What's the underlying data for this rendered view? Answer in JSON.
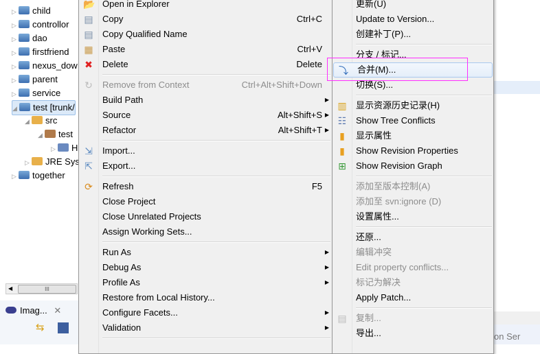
{
  "tree": {
    "items": [
      {
        "label": "child",
        "expanded": false
      },
      {
        "label": "controllor",
        "expanded": false
      },
      {
        "label": "dao",
        "expanded": false
      },
      {
        "label": "firstfriend",
        "expanded": false
      },
      {
        "label": "nexus_dow",
        "expanded": false
      },
      {
        "label": "parent",
        "expanded": false
      },
      {
        "label": "service",
        "expanded": false
      },
      {
        "label": "test [trunk/",
        "expanded": true,
        "selected": true
      },
      {
        "label": "src",
        "expanded": true
      },
      {
        "label": "test",
        "expanded": true
      },
      {
        "label": "H",
        "expanded": false
      },
      {
        "label": "JRE Syst",
        "expanded": false
      },
      {
        "label": "together",
        "expanded": false
      }
    ]
  },
  "bottom": {
    "tab_label": "Imag...",
    "close": "✕",
    "right_tab": "on  Ser"
  },
  "context_menu": [
    {
      "label": "Open in Explorer",
      "icon": "folder-open-icon"
    },
    {
      "label": "Copy",
      "shortcut": "Ctrl+C",
      "icon": "copy-icon"
    },
    {
      "label": "Copy Qualified Name",
      "icon": "copy-qualified-icon"
    },
    {
      "label": "Paste",
      "shortcut": "Ctrl+V",
      "icon": "paste-icon"
    },
    {
      "label": "Delete",
      "shortcut": "Delete",
      "icon": "delete-icon"
    },
    {
      "sep": true
    },
    {
      "label": "Remove from Context",
      "shortcut": "Ctrl+Alt+Shift+Down",
      "disabled": true,
      "icon": "remove-context-icon"
    },
    {
      "label": "Build Path",
      "submenu": true
    },
    {
      "label": "Source",
      "shortcut": "Alt+Shift+S",
      "submenu": true
    },
    {
      "label": "Refactor",
      "shortcut": "Alt+Shift+T",
      "submenu": true
    },
    {
      "sep": true
    },
    {
      "label": "Import...",
      "icon": "import-icon"
    },
    {
      "label": "Export...",
      "icon": "export-icon"
    },
    {
      "sep": true
    },
    {
      "label": "Refresh",
      "shortcut": "F5",
      "icon": "refresh-icon"
    },
    {
      "label": "Close Project"
    },
    {
      "label": "Close Unrelated Projects"
    },
    {
      "label": "Assign Working Sets..."
    },
    {
      "sep": true
    },
    {
      "label": "Run As",
      "submenu": true
    },
    {
      "label": "Debug As",
      "submenu": true
    },
    {
      "label": "Profile As",
      "submenu": true
    },
    {
      "label": "Restore from Local History..."
    },
    {
      "label": "Configure Facets...",
      "submenu": true
    },
    {
      "label": "Validation",
      "submenu": true
    },
    {
      "sep": true
    }
  ],
  "team_submenu": [
    {
      "label": "更新(U)"
    },
    {
      "label": "Update to Version..."
    },
    {
      "label": "创建补丁(P)..."
    },
    {
      "sep": true
    },
    {
      "label": "分支 / 标记..."
    },
    {
      "label": "合并(M)...",
      "icon": "merge-icon",
      "highlighted": true
    },
    {
      "label": "切换(S)..."
    },
    {
      "sep": true
    },
    {
      "label": "显示资源历史记录(H)",
      "icon": "history-icon"
    },
    {
      "label": "Show Tree Conflicts",
      "icon": "tree-conflicts-icon"
    },
    {
      "label": "显示属性",
      "icon": "properties-icon"
    },
    {
      "label": "Show Revision Properties",
      "icon": "revision-properties-icon"
    },
    {
      "label": "Show Revision Graph",
      "icon": "revision-graph-icon"
    },
    {
      "sep": true
    },
    {
      "label": "添加至版本控制(A)",
      "disabled": true
    },
    {
      "label": "添加至 svn:ignore (D)",
      "disabled": true
    },
    {
      "label": "设置属性..."
    },
    {
      "sep": true
    },
    {
      "label": "还原..."
    },
    {
      "label": "编辑冲突",
      "disabled": true
    },
    {
      "label": "Edit property conflicts...",
      "disabled": true
    },
    {
      "label": "标记为解决",
      "disabled": true
    },
    {
      "label": "Apply Patch..."
    },
    {
      "sep": true
    },
    {
      "label": "复制...",
      "disabled": true,
      "icon": "copy-icon"
    },
    {
      "label": "导出..."
    }
  ],
  "colors": {
    "highlight_box": "#ff2cff",
    "menu_bg": "#f0f0f0",
    "disabled_text": "#8d8d8d"
  }
}
